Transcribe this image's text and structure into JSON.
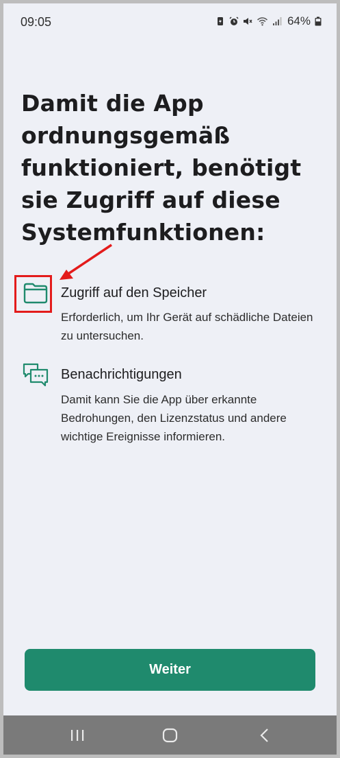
{
  "status_bar": {
    "time": "09:05",
    "battery": "64%",
    "icons": [
      "battery-saver-icon",
      "alarm-icon",
      "mute-icon",
      "wifi-icon",
      "signal-icon",
      "battery-icon"
    ]
  },
  "permission_screen": {
    "title": "Damit die App ordnungsgemäß funktioniert, benötigt sie Zugriff auf diese Systemfunktionen:",
    "permissions": [
      {
        "icon": "folder-icon",
        "title": "Zugriff auf den Speicher",
        "description": "Erforderlich, um Ihr Gerät auf schädliche Dateien zu untersuchen."
      },
      {
        "icon": "chat-bubbles-icon",
        "title": "Benachrichtigungen",
        "description": "Damit kann Sie die App über erkannte Bedrohungen, den Lizenzstatus und andere wichtige Ereignisse informieren."
      }
    ],
    "continue_label": "Weiter"
  },
  "annotation": {
    "color": "#e31b1b"
  },
  "nav_bar": {
    "icons": [
      "recents-icon",
      "home-icon",
      "back-icon"
    ]
  },
  "colors": {
    "accent": "#1f8a6d",
    "background": "#eef0f6"
  }
}
